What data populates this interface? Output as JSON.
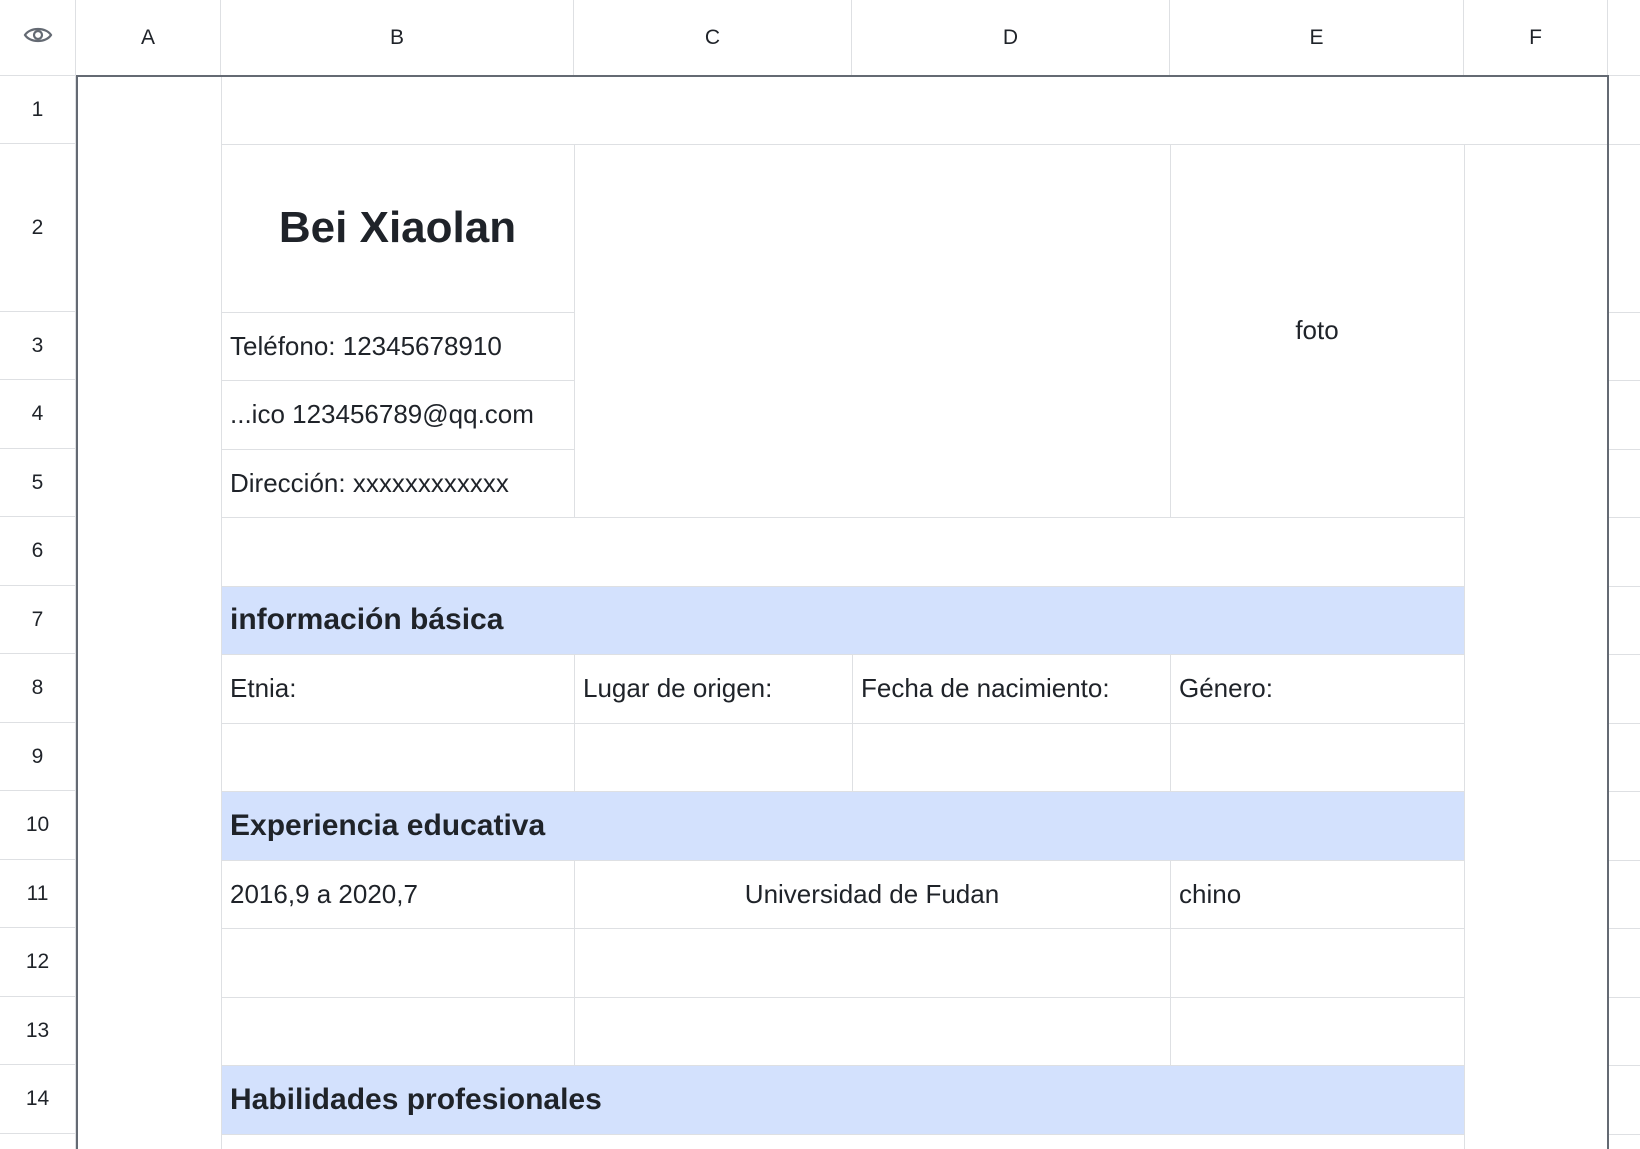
{
  "columns": [
    "A",
    "B",
    "C",
    "D",
    "E",
    "F"
  ],
  "rows": [
    "1",
    "2",
    "3",
    "4",
    "5",
    "6",
    "7",
    "8",
    "9",
    "10",
    "11",
    "12",
    "13",
    "14"
  ],
  "corner_icon": "eye-icon",
  "accent_colors": {
    "section_band": "#d3e1fd",
    "grid": "#dee0e3",
    "frame": "#646a73"
  },
  "resume": {
    "name": "Bei Xiaolan",
    "phone": "Teléfono: 12345678910",
    "email": "...ico 123456789@qq.com",
    "address": "Dirección: xxxxxxxxxxxx",
    "photo": "foto"
  },
  "sections": {
    "basic_info": "información básica",
    "education": "Experiencia educativa",
    "skills": "Habilidades profesionales"
  },
  "basic_fields": {
    "ethnicity": "Etnia:",
    "origin": "Lugar de origen:",
    "birthdate": "Fecha de nacimiento:",
    "gender": "Género:"
  },
  "education_rows": [
    {
      "period": "2016,9 a 2020,7",
      "school": "Universidad de Fudan",
      "major": "chino"
    }
  ]
}
